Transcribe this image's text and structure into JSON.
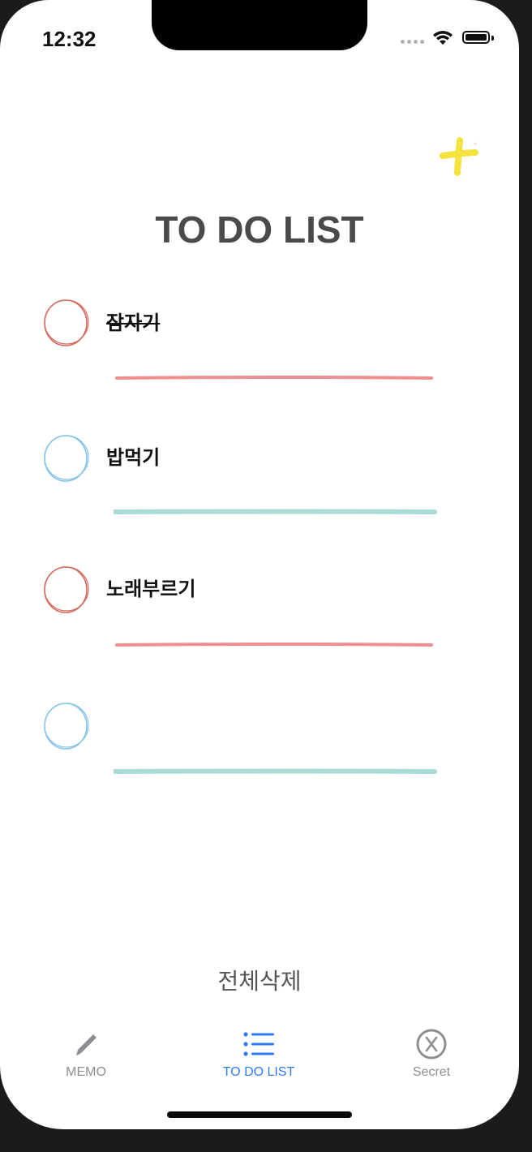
{
  "status_bar": {
    "time": "12:32"
  },
  "header": {
    "title": "TO DO LIST",
    "add_icon": "plus-icon"
  },
  "todos": [
    {
      "text": "잠자기",
      "done": true,
      "color": "#d46a5f",
      "line_color": "#ef8e8e"
    },
    {
      "text": "밥먹기",
      "done": false,
      "color": "#86c3e8",
      "line_color": "#a9dcd6"
    },
    {
      "text": "노래부르기",
      "done": false,
      "color": "#d46a5f",
      "line_color": "#ef8e8e"
    },
    {
      "text": "",
      "done": false,
      "color": "#86c3e8",
      "line_color": "#a9dcd6"
    }
  ],
  "actions": {
    "delete_all": "전체삭제"
  },
  "tabbar": {
    "tabs": [
      {
        "label": "MEMO",
        "icon": "pencil-icon",
        "active": false
      },
      {
        "label": "TO DO LIST",
        "icon": "list-icon",
        "active": true
      },
      {
        "label": "Secret",
        "icon": "close-circle-icon",
        "active": false
      }
    ]
  },
  "colors": {
    "accent": "#2f7bf6",
    "add_button": "#f3e33c",
    "title": "#4a4a4a"
  }
}
